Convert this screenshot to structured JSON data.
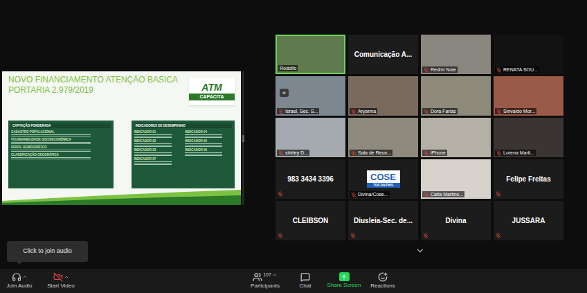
{
  "slide": {
    "title_lines": [
      "NOVO FINANCIAMENTO ATENÇÃO BASICA",
      "PORTARIA 2.979/2019"
    ],
    "logo": [
      "ATM",
      "CAPACITA"
    ],
    "left_panel": {
      "heading": "CAPTAÇÃO PONDERADA",
      "items": [
        "CADASTRO POPULACIONAL",
        "VULNERABILIDADE SOCIOECONÔMICA",
        "PERFIL DEMOGRÁFICO",
        "CLASSIFICAÇÃO GEOGRÁFICA"
      ]
    },
    "right_panel": {
      "heading": "INDICADORES DE DESEMPENHO",
      "items": [
        "INDICADOR 01",
        "INDICADOR 04",
        "INDICADOR 02",
        "INDICADOR 05",
        "INDICADOR 03",
        "INDICADOR 06",
        "INDICADOR 07"
      ]
    }
  },
  "gallery": {
    "tiles": [
      {
        "name": "Rodolfo",
        "kind": "video",
        "muted": false,
        "active": true
      },
      {
        "name": "Comunicação A...",
        "kind": "name",
        "muted": false,
        "active": false
      },
      {
        "name": "Redmi Note",
        "kind": "video",
        "muted": true,
        "active": false
      },
      {
        "name": "RENATA SOU...",
        "kind": "video",
        "muted": true,
        "active": false
      },
      {
        "name": "Israel, Sec. S...",
        "kind": "video",
        "muted": true,
        "active": false
      },
      {
        "name": "Aryanna",
        "kind": "video",
        "muted": true,
        "active": false
      },
      {
        "name": "Dora Farias",
        "kind": "video",
        "muted": true,
        "active": false
      },
      {
        "name": "Sinvaldo Mor...",
        "kind": "video",
        "muted": true,
        "active": false
      },
      {
        "name": "shirley D...",
        "kind": "video",
        "muted": true,
        "active": false
      },
      {
        "name": "Sala de Reun...",
        "kind": "video",
        "muted": true,
        "active": false
      },
      {
        "name": "iPhone",
        "kind": "video",
        "muted": true,
        "active": false
      },
      {
        "name": "Lorena Marti...",
        "kind": "video",
        "muted": true,
        "active": false
      },
      {
        "name": "983 3434 3396",
        "kind": "name",
        "muted": true,
        "active": false
      },
      {
        "name": "Divina/Cose...",
        "kind": "logo",
        "logo": [
          "COSE",
          "TOCANTINS"
        ],
        "muted": true,
        "active": false
      },
      {
        "name": "Catia Martins...",
        "kind": "video",
        "muted": true,
        "active": false
      },
      {
        "name": "Felipe Freitas",
        "kind": "name",
        "muted": true,
        "active": false
      },
      {
        "name": "CLEIBSON",
        "kind": "name",
        "muted": true,
        "active": false
      },
      {
        "name": "Diusleia-Sec. de...",
        "kind": "name",
        "muted": true,
        "active": false
      },
      {
        "name": "Divina",
        "kind": "name",
        "muted": true,
        "active": false
      },
      {
        "name": "JUSSARA",
        "kind": "name",
        "muted": true,
        "active": false
      }
    ],
    "collapse": "«"
  },
  "tooltip": "Click to join audio",
  "toolbar": {
    "left": [
      {
        "label": "Join Audio"
      },
      {
        "label": "Start Video"
      }
    ],
    "center": [
      {
        "label": "Participants",
        "count": "107"
      },
      {
        "label": "Chat"
      },
      {
        "label": "Share Screen"
      },
      {
        "label": "Reactions"
      }
    ]
  }
}
